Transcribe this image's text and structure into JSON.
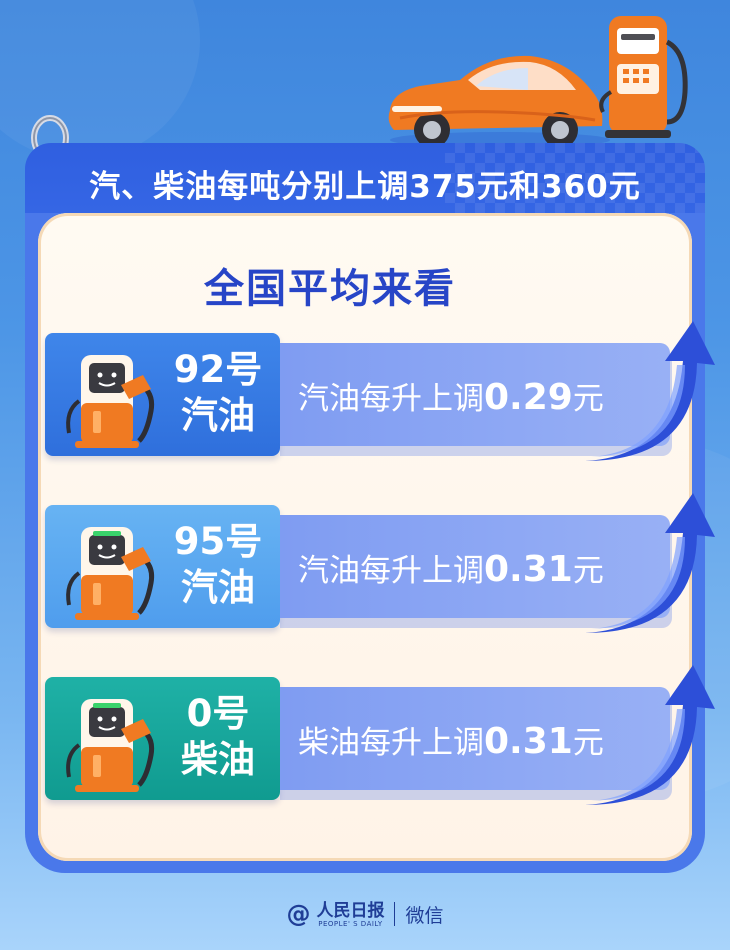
{
  "headline": "汽、柴油每吨分别上调375元和360元",
  "section_title": "全国平均来看",
  "fuels": [
    {
      "name_line1": "92号",
      "name_line2": "汽油",
      "info_prefix": "汽油每升上调",
      "amount": "0.29",
      "unit": "元",
      "tag_color": "#3a7ee6"
    },
    {
      "name_line1": "95号",
      "name_line2": "汽油",
      "info_prefix": "汽油每升上调",
      "amount": "0.31",
      "unit": "元",
      "tag_color": "#5aa7ef"
    },
    {
      "name_line1": "0号",
      "name_line2": "柴油",
      "info_prefix": "柴油每升上调",
      "amount": "0.31",
      "unit": "元",
      "tag_color": "#16a59b"
    }
  ],
  "footer": {
    "at": "@",
    "brand": "人民日报",
    "brand_sub": "PEOPLE' S DAILY",
    "channel": "微信"
  },
  "colors": {
    "title_blue": "#2745c7",
    "header_blue": "#3768e6",
    "band_purple": "#8ba6f3",
    "arrow_blue": "#3556e0"
  },
  "icons": [
    "car-illustration",
    "gas-pump-illustration",
    "up-arrow-icon",
    "fuel-pump-icon"
  ]
}
